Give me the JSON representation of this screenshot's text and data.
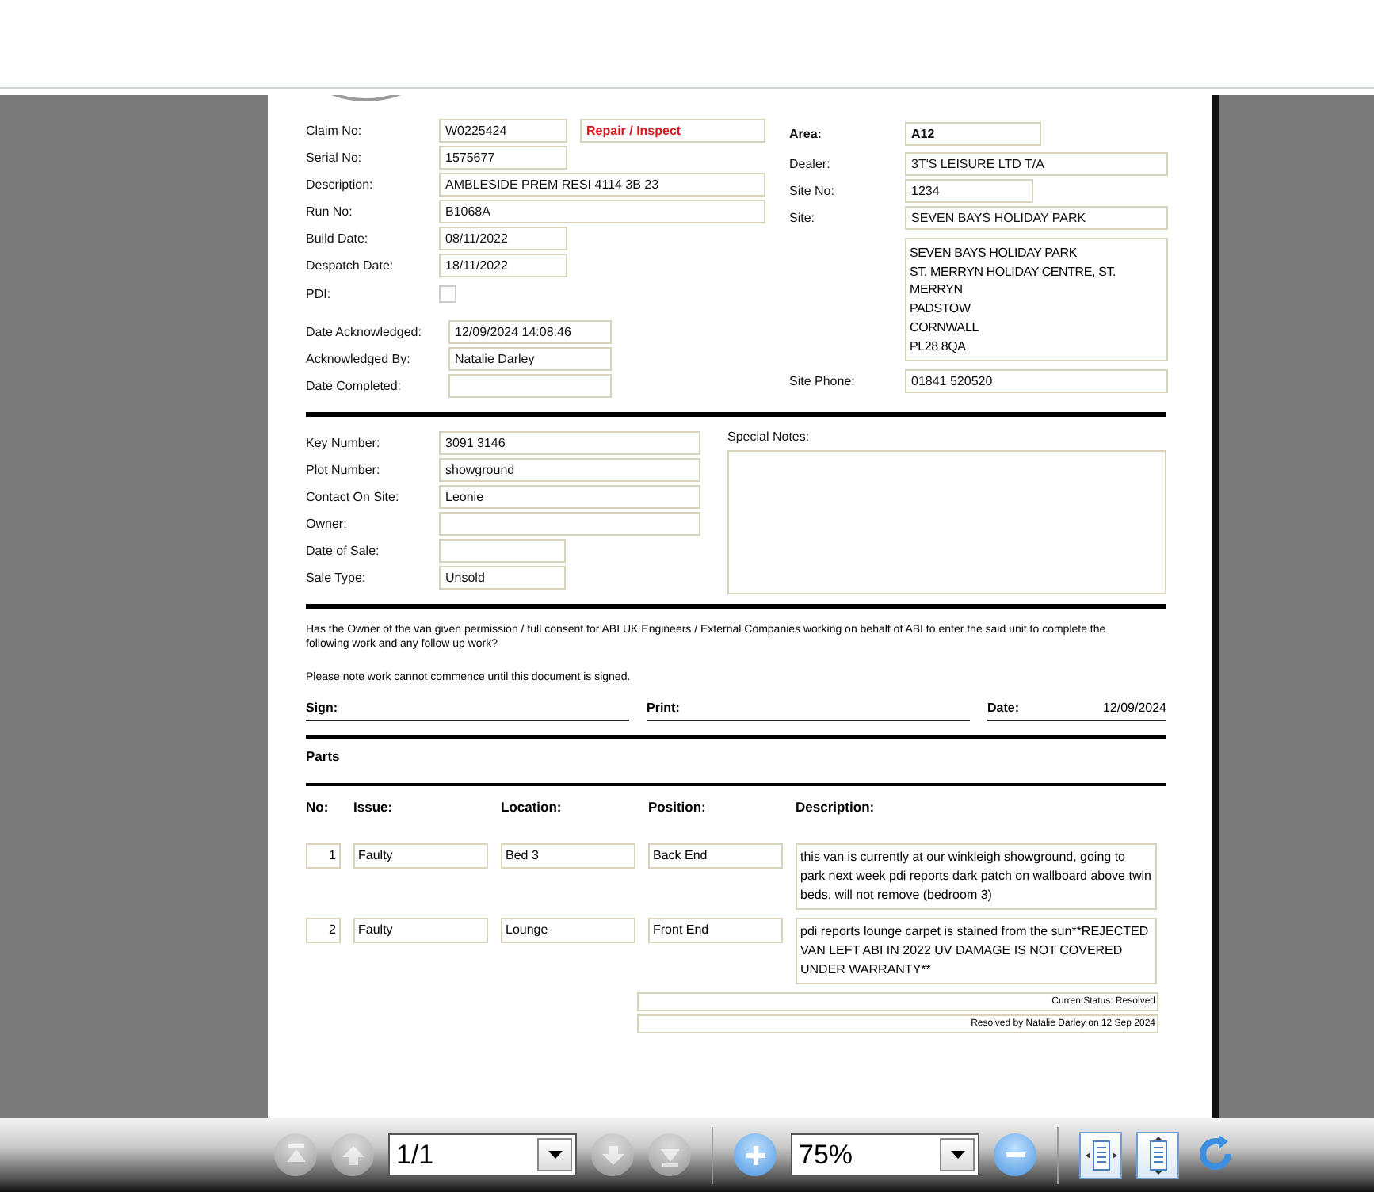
{
  "claim_left": [
    {
      "label": "Claim No:",
      "value": "W0225424",
      "kind": "short",
      "tag": "Repair / Inspect"
    },
    {
      "label": "Serial No:",
      "value": "1575677",
      "kind": "short"
    },
    {
      "label": "Description:",
      "value": "AMBLESIDE PREM RESI 4114 3B 23",
      "kind": "wide"
    },
    {
      "label": "Run No:",
      "value": "B1068A",
      "kind": "wide"
    },
    {
      "label": "Build Date:",
      "value": "08/11/2022",
      "kind": "short"
    },
    {
      "label": "Despatch Date:",
      "value": "18/11/2022",
      "kind": "short"
    },
    {
      "label": "PDI:",
      "kind": "checkbox",
      "checked": false
    }
  ],
  "acknowledgement": [
    {
      "label": "Date Acknowledged:",
      "value": "12/09/2024 14:08:46"
    },
    {
      "label": "Acknowledged By:",
      "value": "Natalie Darley"
    },
    {
      "label": "Date Completed:"
    }
  ],
  "claim_right": [
    {
      "label": "Area:",
      "value": "A12",
      "kind": "bold"
    },
    {
      "label": "Dealer:",
      "value": "3T'S LEISURE LTD T/A",
      "kind": "wide"
    },
    {
      "label": "Site No:",
      "value": "1234",
      "kind": "short"
    },
    {
      "label": "Site:",
      "value": "SEVEN BAYS HOLIDAY PARK",
      "kind": "wide"
    },
    {
      "kind": "address",
      "lines": [
        "SEVEN BAYS HOLIDAY PARK",
        "ST. MERRYN HOLIDAY CENTRE, ST.",
        "MERRYN",
        "PADSTOW",
        "CORNWALL",
        "PL28 8QA"
      ]
    },
    {
      "label": "Site Phone:",
      "value": "01841 520520",
      "kind": "wide"
    }
  ],
  "site_details": [
    {
      "label": "Key Number:",
      "value": "3091 3146",
      "kind": "wide"
    },
    {
      "label": "Plot Number:",
      "value": "showground",
      "kind": "wide"
    },
    {
      "label": "Contact On Site:",
      "value": "Leonie",
      "kind": "wide"
    },
    {
      "label": "Owner:",
      "kind": "wide"
    },
    {
      "label": "Date of Sale:",
      "kind": "short"
    },
    {
      "label": "Sale Type:",
      "value": "Unsold",
      "kind": "short"
    }
  ],
  "special_notes": {
    "label": "Special Notes:"
  },
  "consent": {
    "question": "Has the Owner of the van given permission / full consent for ABI UK Engineers / External Companies working on behalf of ABI to enter the said unit to complete the following work and any follow up work?",
    "note": "Please note work cannot commence until this document is signed.",
    "sign": "Sign:",
    "print": "Print:",
    "date_label": "Date:",
    "date": "12/09/2024"
  },
  "parts": {
    "title": "Parts",
    "columns": [
      "No:",
      "Issue:",
      "Location:",
      "Position:",
      "Description:"
    ],
    "rows": [
      {
        "no": "1",
        "issue": "Faulty",
        "location": "Bed 3",
        "position": "Back End",
        "description": "this van is currently at our winkleigh showground, going to park next week pdi reports dark patch on wallboard above twin beds, will not remove (bedroom 3)"
      },
      {
        "no": "2",
        "issue": "Faulty",
        "location": "Lounge",
        "position": "Front End",
        "description": "pdi reports lounge carpet is stained from the sun**REJECTED VAN LEFT ABI IN 2022 UV DAMAGE IS NOT COVERED UNDER WARRANTY**"
      }
    ],
    "status": [
      "CurrentStatus: Resolved",
      "Resolved by Natalie Darley on 12 Sep 2024"
    ]
  },
  "toolbar": [
    {
      "kind": "first",
      "disabled": true
    },
    {
      "kind": "up",
      "disabled": true
    },
    {
      "kind": "select",
      "value": "1/1"
    },
    {
      "kind": "down",
      "disabled": true
    },
    {
      "kind": "last",
      "disabled": true
    },
    {
      "kind": "separator"
    },
    {
      "kind": "zoom_in",
      "disabled": false
    },
    {
      "kind": "select",
      "value": "75%"
    },
    {
      "kind": "zoom_out",
      "disabled": false
    },
    {
      "kind": "separator"
    },
    {
      "kind": "fit_width",
      "disabled": false
    },
    {
      "kind": "fit_height",
      "disabled": false
    },
    {
      "kind": "rotate",
      "disabled": false
    }
  ]
}
